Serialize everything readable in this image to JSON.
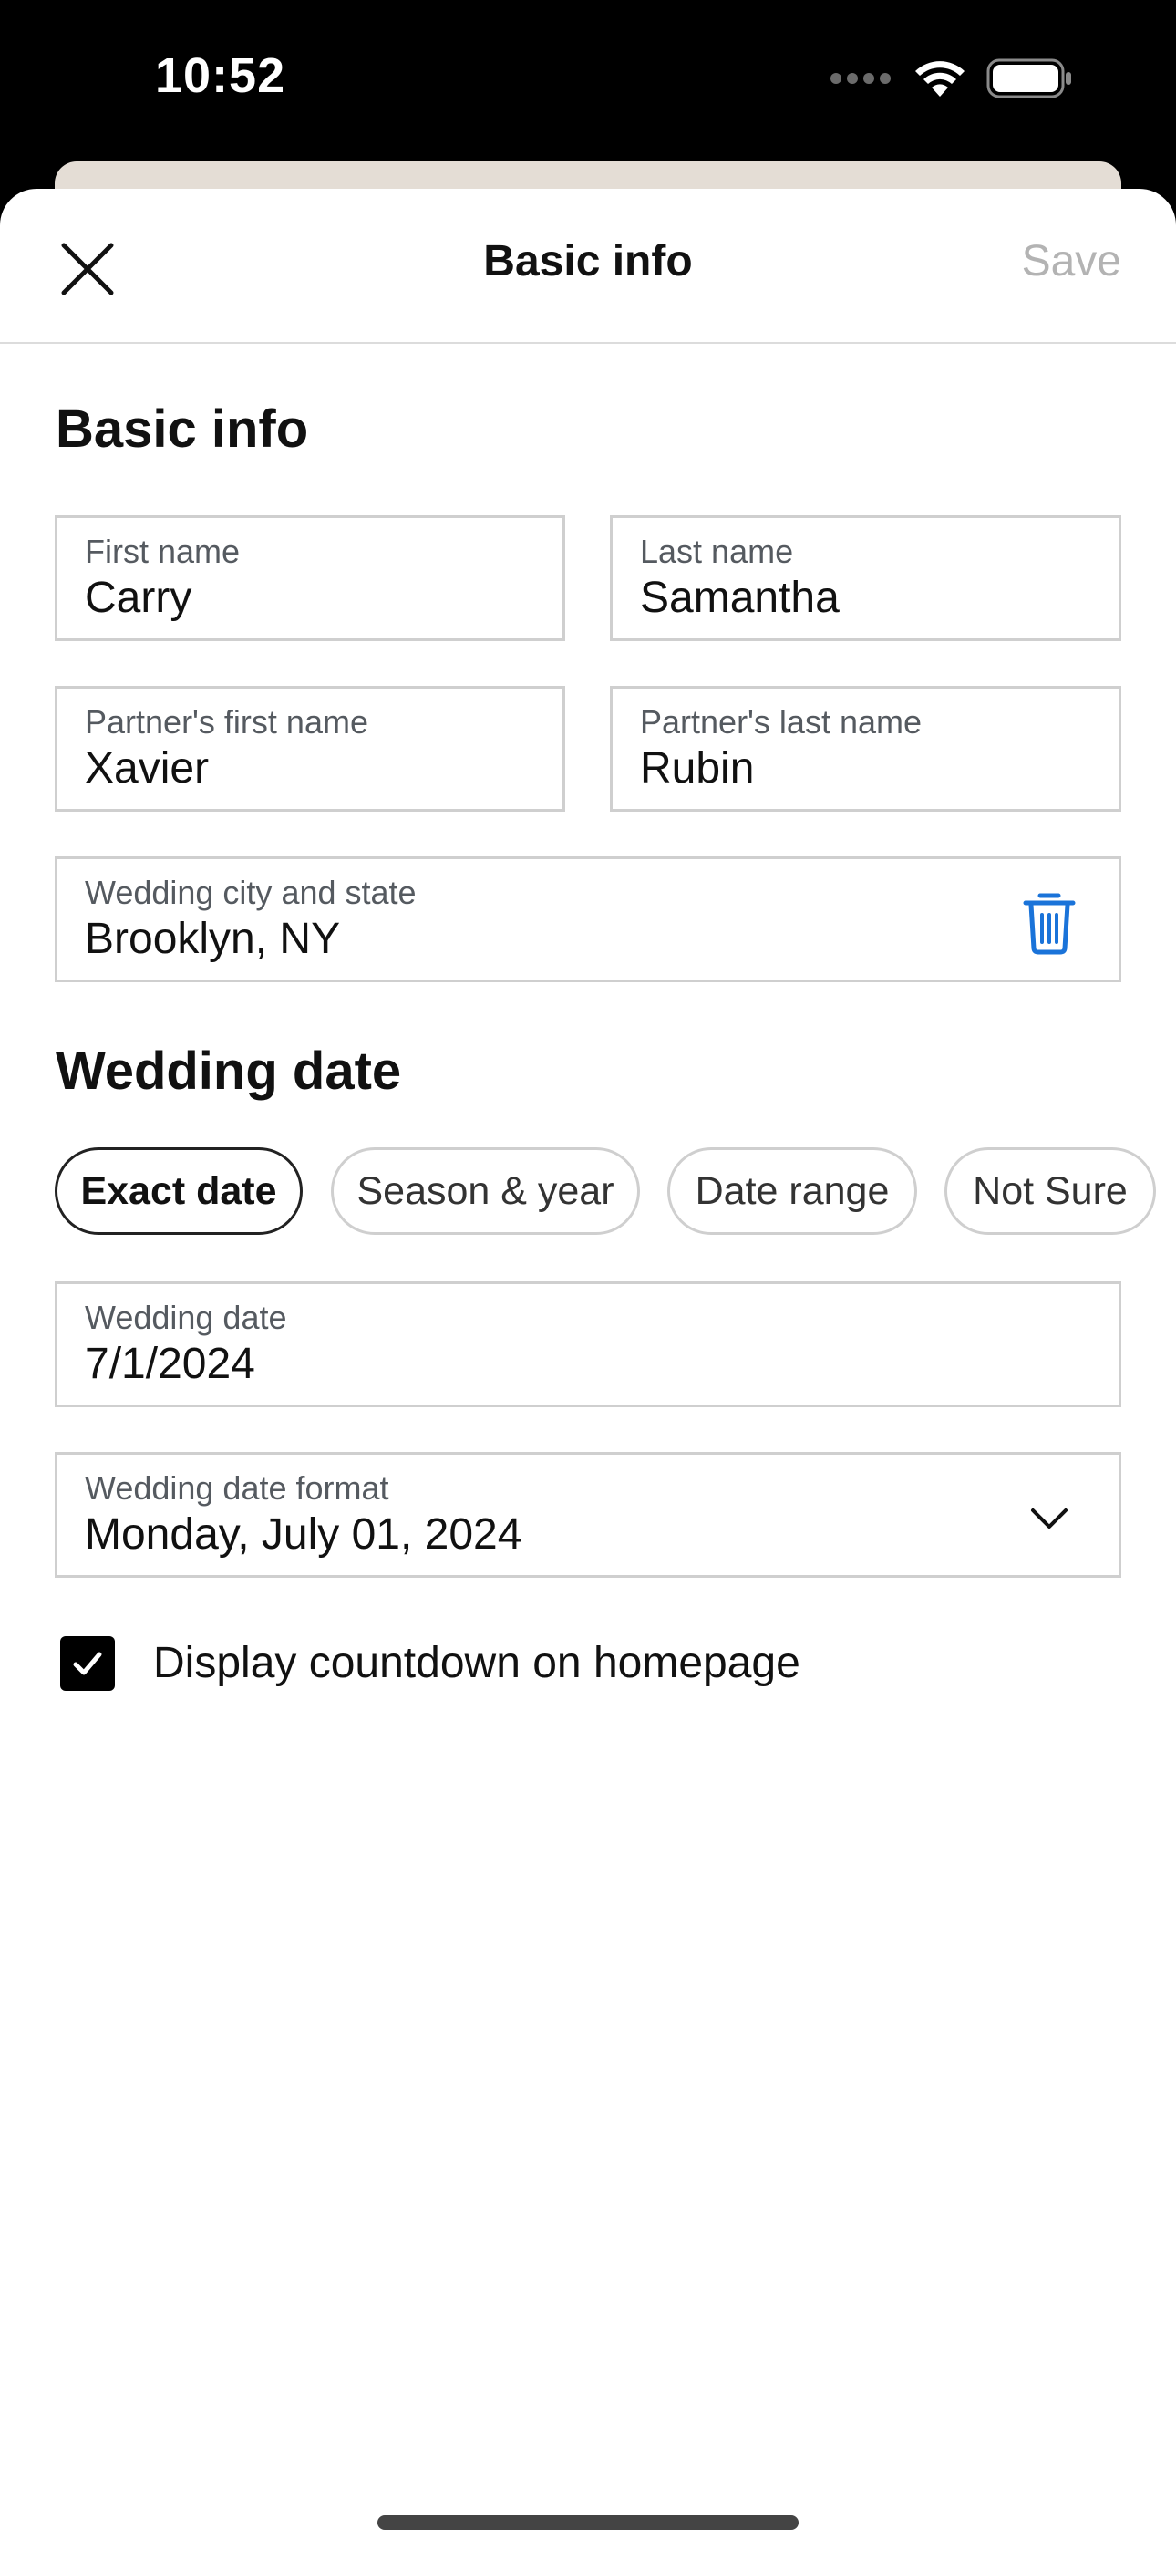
{
  "status_bar": {
    "time": "10:52"
  },
  "header": {
    "title": "Basic info",
    "save_label": "Save"
  },
  "basic_info": {
    "section_title": "Basic info",
    "first_name": {
      "label": "First name",
      "value": "Carry"
    },
    "last_name": {
      "label": "Last name",
      "value": "Samantha"
    },
    "partner_first_name": {
      "label": "Partner's first name",
      "value": "Xavier"
    },
    "partner_last_name": {
      "label": "Partner's last name",
      "value": "Rubin"
    },
    "city_state": {
      "label": "Wedding city and state",
      "value": "Brooklyn, NY"
    }
  },
  "wedding_date": {
    "section_title": "Wedding date",
    "chips": [
      {
        "label": "Exact date",
        "selected": true
      },
      {
        "label": "Season & year",
        "selected": false
      },
      {
        "label": "Date range",
        "selected": false
      },
      {
        "label": "Not Sure",
        "selected": false
      }
    ],
    "date_field": {
      "label": "Wedding date",
      "value": "7/1/2024"
    },
    "format_field": {
      "label": "Wedding date format",
      "value": "Monday, July 01, 2024"
    },
    "countdown": {
      "label": "Display countdown on homepage",
      "checked": true
    }
  },
  "icons": {
    "close": "close-icon",
    "trash": "trash-icon",
    "chevron": "chevron-down-icon",
    "check": "checkmark-icon"
  },
  "colors": {
    "accent_blue": "#1a73d9",
    "save_disabled": "#b3b3b3",
    "field_border": "#cfcfcf"
  }
}
